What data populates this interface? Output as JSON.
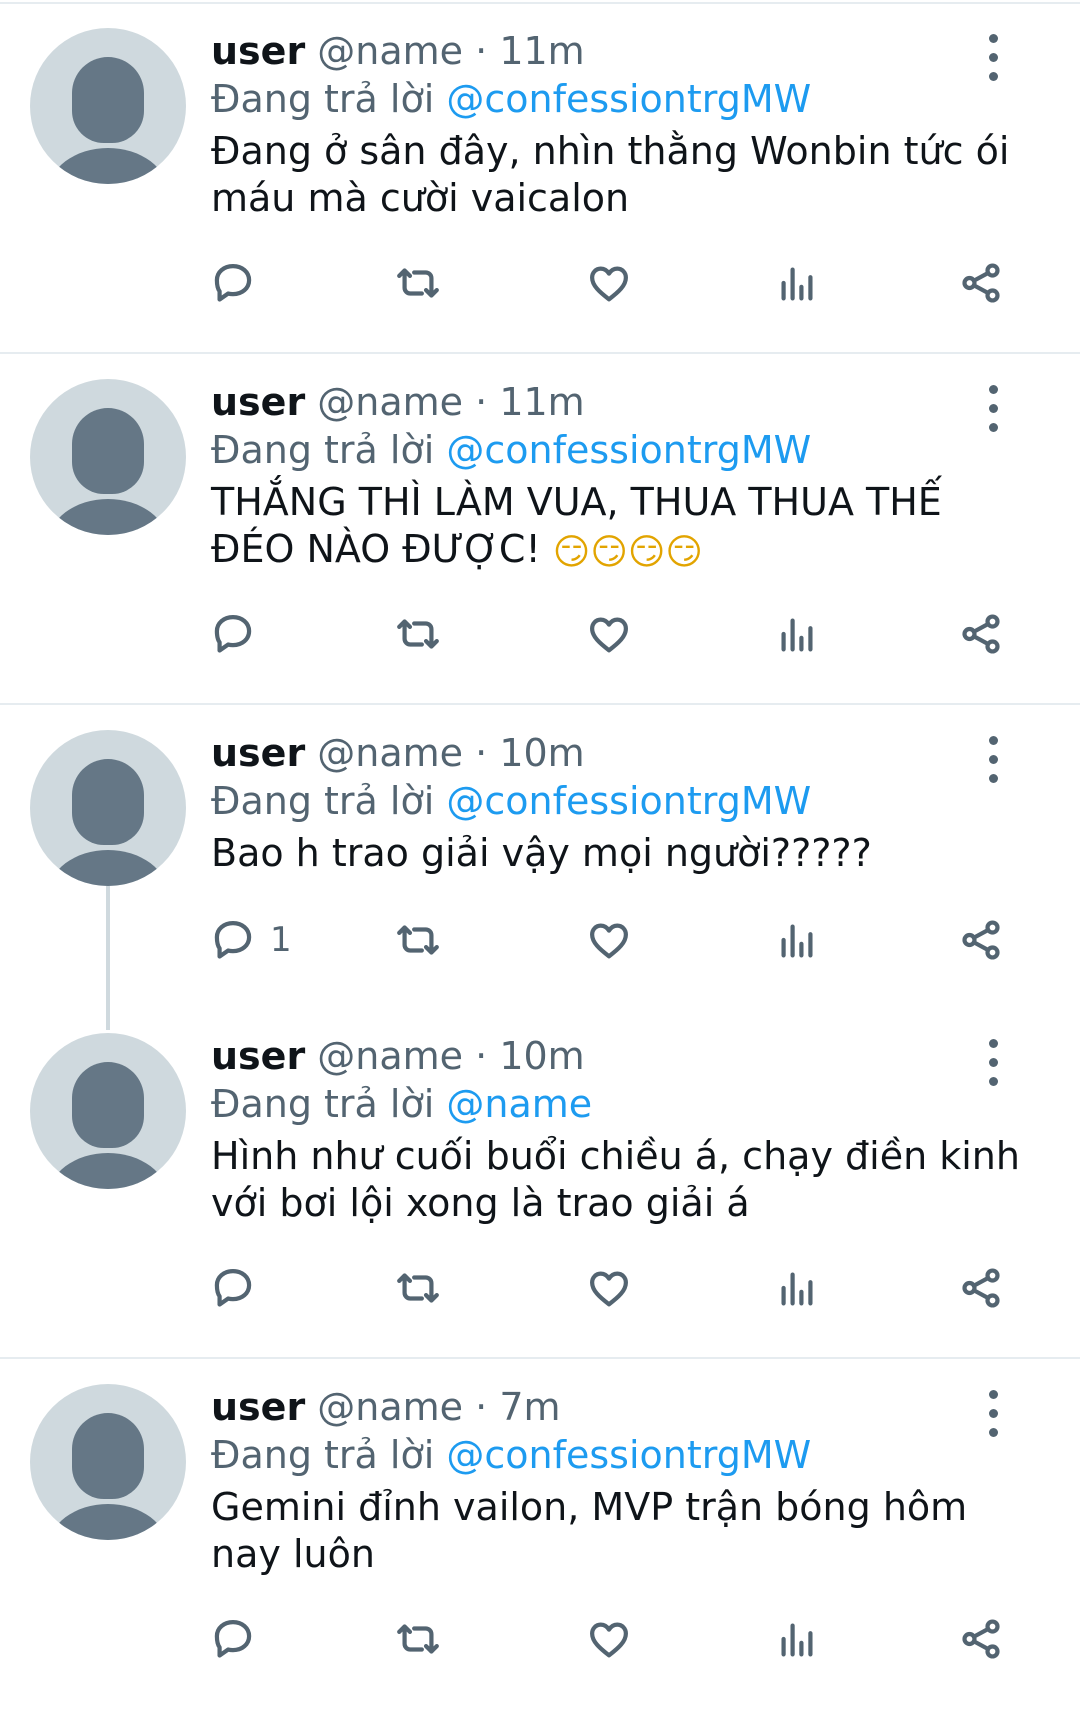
{
  "tweets": [
    {
      "user": "user",
      "handle": "@name",
      "sep": "·",
      "time": "11m",
      "reply_prefix": "Đang trả lời",
      "reply_to": "@confessiontrgMW",
      "text": "Đang ở sân đây, nhìn thằng Wonbin tức ói máu mà cười vaicalon",
      "reply_count": ""
    },
    {
      "user": "user",
      "handle": "@name",
      "sep": "·",
      "time": "11m",
      "reply_prefix": "Đang trả lời",
      "reply_to": "@confessiontrgMW",
      "text": "THẮNG THÌ LÀM VUA, THUA THUA THẾ ĐÉO NÀO ĐƯỢC!",
      "emojis": [
        "😏",
        "😏",
        "😏",
        "😏"
      ],
      "reply_count": ""
    },
    {
      "user": "user",
      "handle": "@name",
      "sep": "·",
      "time": "10m",
      "reply_prefix": "Đang trả lời",
      "reply_to": "@confessiontrgMW",
      "text": "Bao h trao giải vậy mọi người?????",
      "reply_count": "1"
    },
    {
      "user": "user",
      "handle": "@name",
      "sep": "·",
      "time": "10m",
      "reply_prefix": "Đang trả lời",
      "reply_to": "@name",
      "text": "Hình như cuối buổi chiều á, chạy điền kinh với bơi lội xong là trao giải á",
      "reply_count": ""
    },
    {
      "user": "user",
      "handle": "@name",
      "sep": "·",
      "time": "7m",
      "reply_prefix": "Đang trả lời",
      "reply_to": "@confessiontrgMW",
      "text": "Gemini đỉnh vailon, MVP trận bóng hôm nay luôn",
      "reply_count": ""
    }
  ],
  "icons": {
    "reply": "reply-icon",
    "retweet": "retweet-icon",
    "like": "like-icon",
    "views": "views-icon",
    "share": "share-icon",
    "more": "more-vertical-icon"
  },
  "colors": {
    "link": "#1d9bf0",
    "secondary": "#536471",
    "text": "#0f1419",
    "avatar_bg": "#cfd9de",
    "avatar_fg": "#657786",
    "divider": "#e6ecf0"
  }
}
